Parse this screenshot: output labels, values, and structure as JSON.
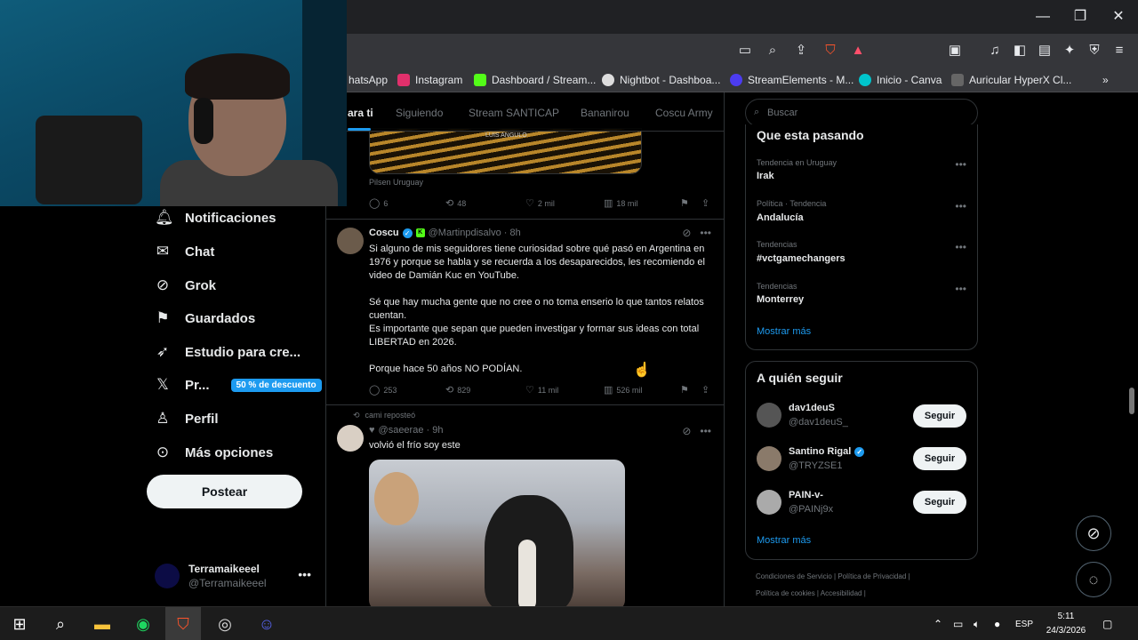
{
  "browser": {
    "bookmarks": [
      {
        "label": "hatsApp",
        "color": "#25d366"
      },
      {
        "label": "Instagram",
        "color": "#e1306c"
      },
      {
        "label": "Dashboard / Stream...",
        "color": "#53fc18"
      },
      {
        "label": "Nightbot - Dashboa...",
        "color": "#ffffff"
      },
      {
        "label": "StreamElements - M...",
        "color": "#4c3cf0"
      },
      {
        "label": "Inicio - Canva",
        "color": "#00c4cc"
      },
      {
        "label": "Auricular HyperX Cl...",
        "color": "#666666"
      }
    ]
  },
  "nav": {
    "notifications": "Notificaciones",
    "chat": "Chat",
    "grok": "Grok",
    "bookmarks": "Guardados",
    "studio": "Estudio para cre...",
    "premium": "Pr...",
    "promo": "50 % de descuento",
    "profile": "Perfil",
    "more": "Más opciones",
    "post_button": "Postear",
    "account_name": "Terramaikeeel",
    "account_handle": "@Terramaikeeel"
  },
  "tabs": [
    "ara ti",
    "Siguiendo",
    "Stream SANTICAP",
    "Bananirou",
    "Coscu Army"
  ],
  "feed": {
    "prev_post": {
      "image_caption": "LUIS ANGULO",
      "source": "Pilsen Uruguay",
      "replies": "6",
      "reposts": "48",
      "likes": "2 mil",
      "views": "18 mil"
    },
    "post1": {
      "name": "Coscu",
      "handle": "@Martinpdisalvo · 8h",
      "p1": "Si alguno de mis seguidores tiene curiosidad sobre qué pasó en Argentina en 1976 y porque se habla y se recuerda a los desaparecidos, les recomiendo el video de Damián Kuc en YouTube.",
      "p2": "Sé que hay mucha gente que no cree o no toma enserio lo que tantos relatos cuentan.",
      "p3": "Es importante que sepan que pueden investigar y formar sus ideas con total LIBERTAD en 2026.",
      "p4": "Porque hace 50 años NO PODÍAN.",
      "replies": "253",
      "reposts": "829",
      "likes": "11 mil",
      "views": "526 mil"
    },
    "post2": {
      "repost_label": "cami reposteó",
      "handle": "@saeerae · 9h",
      "text": "volvió el frío soy este"
    }
  },
  "right": {
    "search_placeholder": "Buscar",
    "trends_title": "Que esta pasando",
    "trends": [
      {
        "context": "Tendencia en Uruguay",
        "name": "Irak"
      },
      {
        "context": "Política · Tendencia",
        "name": "Andalucía"
      },
      {
        "context": "Tendencias",
        "name": "#vctgamechangers"
      },
      {
        "context": "Tendencias",
        "name": "Monterrey"
      }
    ],
    "show_more": "Mostrar más",
    "who_title": "A quién seguir",
    "who": [
      {
        "name": "dav1deuS",
        "handle": "@dav1deuS_",
        "verified": false
      },
      {
        "name": "Santino Rigal",
        "handle": "@TRYZSE1",
        "verified": true
      },
      {
        "name": "PAIN-v-",
        "handle": "@PAINj9x",
        "verified": false
      }
    ],
    "follow_label": "Seguir",
    "footer1": "Condiciones de Servicio  |  Política de Privacidad  |",
    "footer2": "Política de cookies  |  Accesibilidad  |"
  },
  "taskbar": {
    "lang": "ESP",
    "time": "5:11",
    "date": "24/3/2026"
  }
}
